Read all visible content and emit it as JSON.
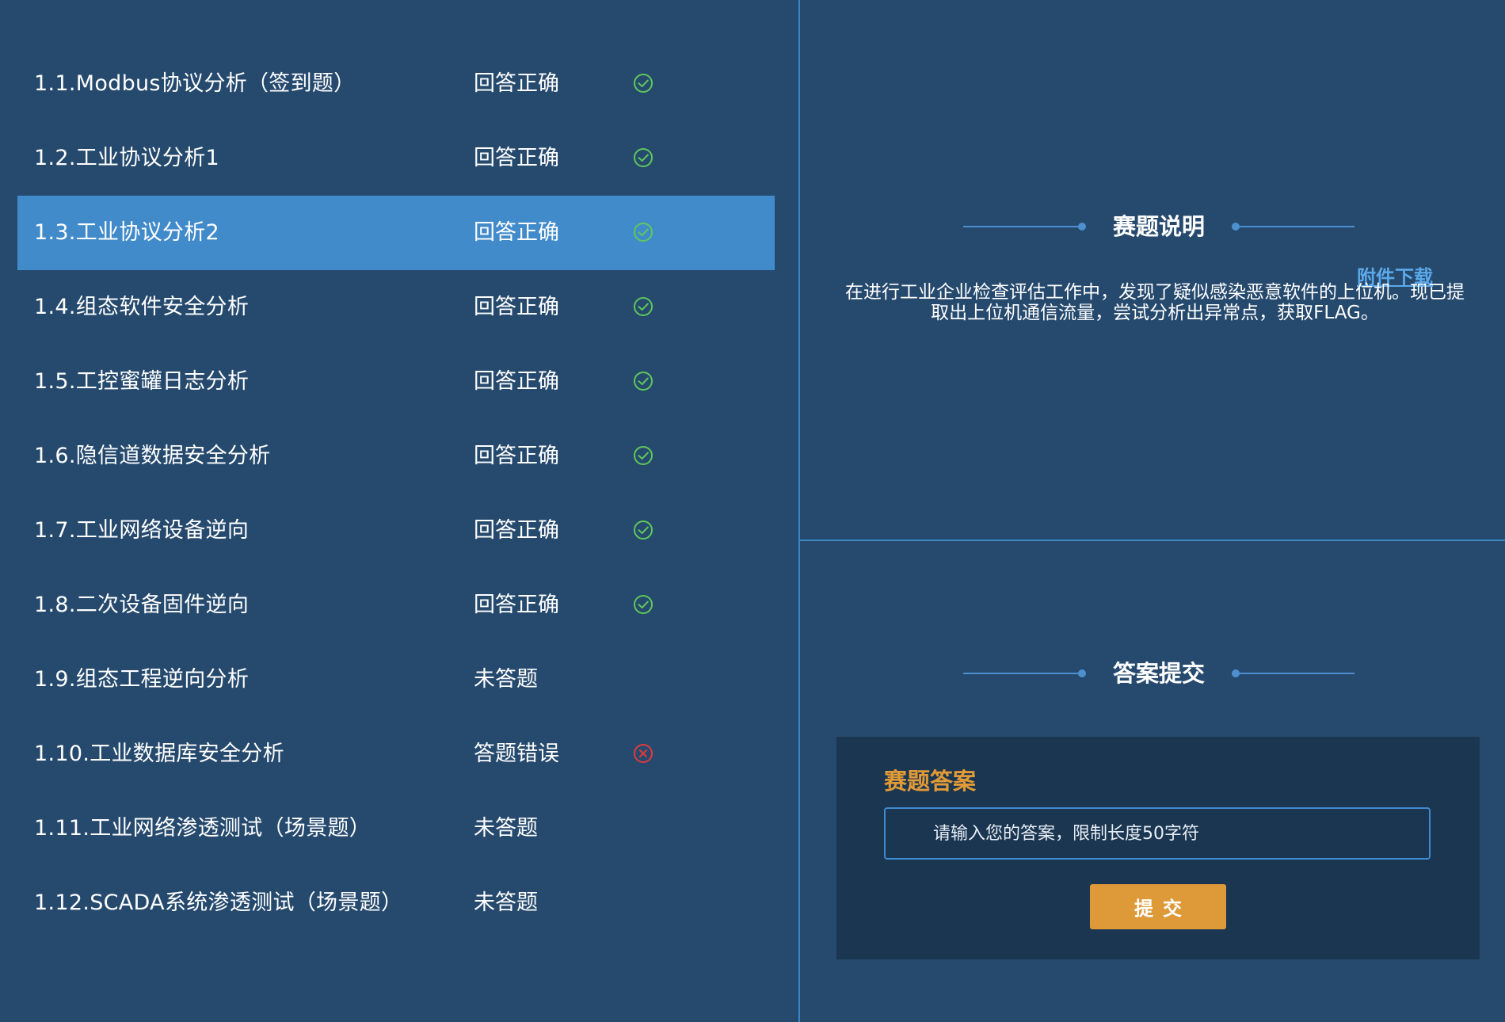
{
  "challenges": [
    {
      "title": "1.1.Modbus协议分析（签到题）",
      "status": "回答正确",
      "result": "correct",
      "active": false
    },
    {
      "title": "1.2.工业协议分析1",
      "status": "回答正确",
      "result": "correct",
      "active": false
    },
    {
      "title": "1.3.工业协议分析2",
      "status": "回答正确",
      "result": "correct",
      "active": true
    },
    {
      "title": "1.4.组态软件安全分析",
      "status": "回答正确",
      "result": "correct",
      "active": false
    },
    {
      "title": "1.5.工控蜜罐日志分析",
      "status": "回答正确",
      "result": "correct",
      "active": false
    },
    {
      "title": "1.6.隐信道数据安全分析",
      "status": "回答正确",
      "result": "correct",
      "active": false
    },
    {
      "title": "1.7.工业网络设备逆向",
      "status": "回答正确",
      "result": "correct",
      "active": false
    },
    {
      "title": "1.8.二次设备固件逆向",
      "status": "回答正确",
      "result": "correct",
      "active": false
    },
    {
      "title": "1.9.组态工程逆向分析",
      "status": "未答题",
      "result": "none",
      "active": false
    },
    {
      "title": "1.10.工业数据库安全分析",
      "status": "答题错误",
      "result": "wrong",
      "active": false
    },
    {
      "title": "1.11.工业网络渗透测试（场景题）",
      "status": "未答题",
      "result": "none",
      "active": false
    },
    {
      "title": "1.12.SCADA系统渗透测试（场景题）",
      "status": "未答题",
      "result": "none",
      "active": false
    }
  ],
  "description": {
    "heading": "赛题说明",
    "attachment_link": "附件下载",
    "text": "在进行工业企业检查评估工作中，发现了疑似感染恶意软件的上位机。现已提取出上位机通信流量，尝试分析出异常点，获取FLAG。"
  },
  "answer": {
    "heading": "答案提交",
    "box_title": "赛题答案",
    "input_value": "",
    "input_placeholder": "请输入您的答案，限制长度50字符",
    "submit_label": "提交"
  },
  "colors": {
    "background": "#264a6e",
    "active_row": "#418bcb",
    "correct": "#5fc85a",
    "wrong": "#e2393c",
    "accent": "#de9a38",
    "link": "#5ba9ea",
    "divider": "#3c86c6"
  },
  "icons": {
    "correct": "check-circle-icon",
    "wrong": "x-circle-icon"
  }
}
